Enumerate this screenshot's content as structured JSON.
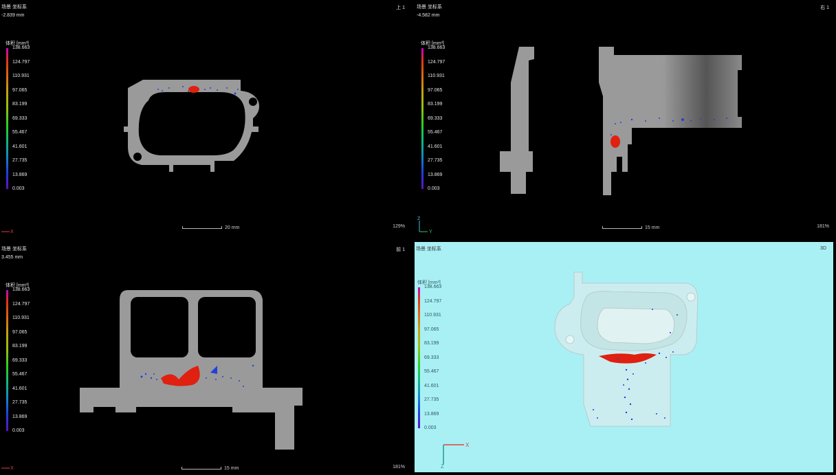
{
  "colors": {
    "background": "#000000",
    "viewport_3d_bg": "#a9f0f5",
    "part_gray": "#9a9a9a",
    "defect_red": "#e02010",
    "defect_blue": "#2040e0"
  },
  "legend": {
    "title": "体积 [mm³]",
    "ticks": [
      "138.663",
      "124.797",
      "110.931",
      "97.065",
      "83.199",
      "69.333",
      "55.467",
      "41.601",
      "27.735",
      "13.869",
      "0.003"
    ]
  },
  "legend_3d": {
    "title": "体积 [mm³]",
    "ticks": [
      "138.663",
      "124.797",
      "110.931",
      "97.065",
      "83.199",
      "69.333",
      "55.467",
      "41.601",
      "27.735",
      "13.869",
      "0.003"
    ]
  },
  "viewports": {
    "top": {
      "title": "场景 坐标系",
      "depth": "-2.839 mm",
      "name": "上 1",
      "scale_label": "20 mm",
      "zoom": "129%",
      "axis_h": "X",
      "axis_v": "Y"
    },
    "right": {
      "title": "场景 坐标系",
      "depth": "-4.582 mm",
      "name": "右 1",
      "scale_label": "15 mm",
      "zoom": "181%",
      "axis_h": "Y",
      "axis_v": "Z"
    },
    "front": {
      "title": "场景 坐标系",
      "depth": "3.455 mm",
      "name": "前 1",
      "scale_label": "15 mm",
      "zoom": "181%",
      "axis_h": "X",
      "axis_v": "Z"
    },
    "iso": {
      "title": "场景 坐标系",
      "name": "3D",
      "axis_h": "X",
      "axis_v": "Z"
    }
  }
}
